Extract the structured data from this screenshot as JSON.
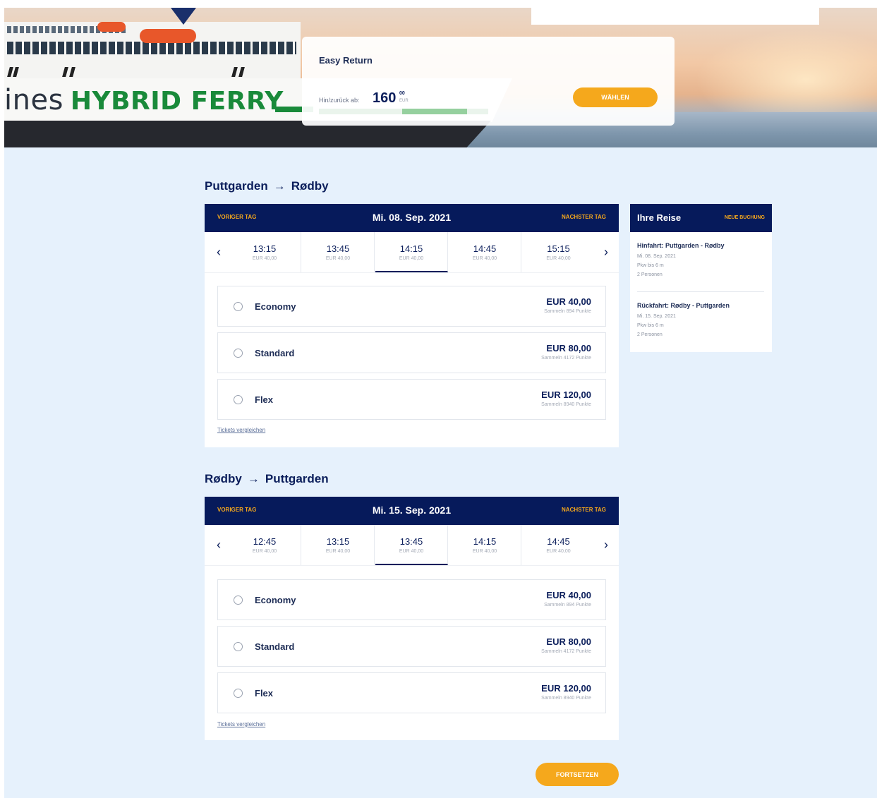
{
  "hero": {
    "ship_text_left": "ines",
    "ship_text_right": "HYBRID FERRY",
    "promo": {
      "title": "Easy Return",
      "from_label": "Hin/zurück ab:",
      "price_main": "160",
      "price_cents": "00",
      "price_currency": "EUR",
      "button_label": "WÄHLEN"
    }
  },
  "outbound": {
    "route_from": "Puttgarden",
    "route_arrow": "→",
    "route_to": "Rødby",
    "prev_day": "VORIGER TAG",
    "date": "Mi. 08. Sep. 2021",
    "next_day": "NACHSTER TAG",
    "slots": [
      {
        "time": "13:15",
        "price": "EUR 40,00"
      },
      {
        "time": "13:45",
        "price": "EUR 40,00"
      },
      {
        "time": "14:15",
        "price": "EUR 40,00"
      },
      {
        "time": "14:45",
        "price": "EUR 40,00"
      },
      {
        "time": "15:15",
        "price": "EUR 40,00"
      }
    ],
    "active_slot": "14:15",
    "fares": [
      {
        "name": "Economy",
        "price": "EUR 40,00",
        "points": "Sammeln 894 Punkte"
      },
      {
        "name": "Standard",
        "price": "EUR 80,00",
        "points": "Sammeln 4172 Punkte"
      },
      {
        "name": "Flex",
        "price": "EUR 120,00",
        "points": "Sammeln 8940 Punkte"
      }
    ],
    "compare_link": "Tickets vergleichen"
  },
  "return": {
    "route_from": "Rødby",
    "route_arrow": "→",
    "route_to": "Puttgarden",
    "prev_day": "VORIGER TAG",
    "date": "Mi. 15. Sep. 2021",
    "next_day": "NACHSTER TAG",
    "slots": [
      {
        "time": "12:45",
        "price": "EUR 40,00"
      },
      {
        "time": "13:15",
        "price": "EUR 40,00"
      },
      {
        "time": "13:45",
        "price": "EUR 40,00"
      },
      {
        "time": "14:15",
        "price": "EUR 40,00"
      },
      {
        "time": "14:45",
        "price": "EUR 40,00"
      }
    ],
    "active_slot": "13:45",
    "fares": [
      {
        "name": "Economy",
        "price": "EUR 40,00",
        "points": "Sammeln 894 Punkte"
      },
      {
        "name": "Standard",
        "price": "EUR 80,00",
        "points": "Sammeln 4172 Punkte"
      },
      {
        "name": "Flex",
        "price": "EUR 120,00",
        "points": "Sammeln 8940 Punkte"
      }
    ],
    "compare_link": "Tickets vergleichen"
  },
  "sidebar": {
    "title": "Ihre Reise",
    "new_booking": "NEUE BUCHUNG",
    "legs": [
      {
        "title": "Hinfahrt: Puttgarden - Rødby",
        "date": "Mi. 08. Sep. 2021",
        "vehicle": "Pkw bis 6 m",
        "persons": "2 Personen"
      },
      {
        "title": "Rückfahrt: Rødby - Puttgarden",
        "date": "Mi. 15. Sep. 2021",
        "vehicle": "Pkw bis 6 m",
        "persons": "2 Personen"
      }
    ]
  },
  "continue_label": "FORTSETZEN",
  "colors": {
    "navy": "#061a5b",
    "orange": "#f5a81c",
    "page_bg": "#e6f1fc",
    "ferry_green": "#198a3a"
  },
  "icons": {
    "prev": "chevron-left-icon",
    "next": "chevron-right-icon",
    "radio": "radio-unchecked-icon",
    "arrow": "arrow-right-icon"
  }
}
